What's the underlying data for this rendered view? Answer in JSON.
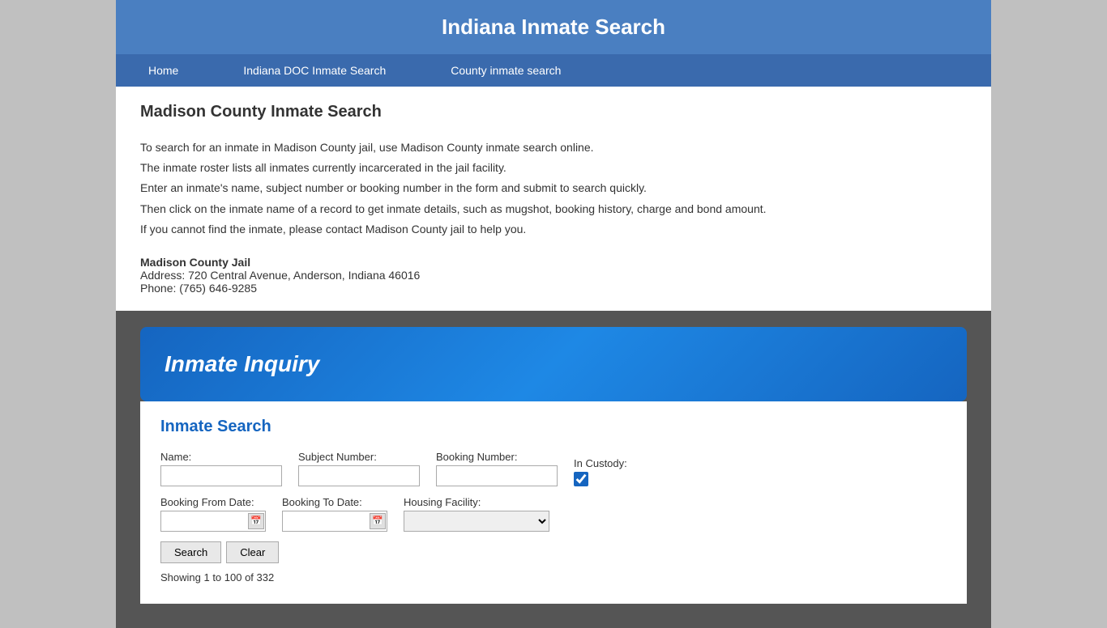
{
  "site": {
    "header_title": "Indiana Inmate Search"
  },
  "nav": {
    "items": [
      {
        "label": "Home",
        "id": "home"
      },
      {
        "label": "Indiana DOC Inmate Search",
        "id": "doc-search"
      },
      {
        "label": "County inmate search",
        "id": "county-search"
      }
    ]
  },
  "page": {
    "title": "Madison County Inmate Search",
    "description_lines": [
      "To search for an inmate in Madison County jail, use Madison County inmate search online.",
      "The inmate roster lists all inmates currently incarcerated in the jail facility.",
      "Enter an inmate's name, subject number or booking number in the form and submit to search quickly.",
      "Then click on the inmate name of a record to get inmate details, such as mugshot, booking history, charge and bond amount.",
      "If you cannot find the inmate, please contact Madison County jail to help you."
    ],
    "jail_name": "Madison County Jail",
    "jail_address": "Address: 720 Central Avenue, Anderson, Indiana 46016",
    "jail_phone": "Phone: (765) 646-9285"
  },
  "inquiry": {
    "section_title": "Inmate Inquiry",
    "form_title": "Inmate Search",
    "fields": {
      "name_label": "Name:",
      "subject_number_label": "Subject Number:",
      "booking_number_label": "Booking Number:",
      "in_custody_label": "In Custody:",
      "booking_from_label": "Booking From Date:",
      "booking_to_label": "Booking To Date:",
      "housing_facility_label": "Housing Facility:"
    },
    "buttons": {
      "search_label": "Search",
      "clear_label": "Clear"
    },
    "results_count": "Showing 1 to 100 of 332"
  }
}
